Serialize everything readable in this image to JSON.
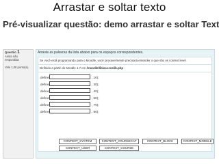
{
  "slide": {
    "title": "Arrastar e soltar texto"
  },
  "page": {
    "heading": "Pré-visualizar questão: demo arrastar e soltar Texto"
  },
  "info": {
    "question_label": "Questão",
    "question_number": "1",
    "status_line1": "Ainda não",
    "status_line2": "respondida",
    "score": "Vale 1,00 ponto(s)."
  },
  "question": {
    "prompt": "Arraste as palavras da lista abaixo para os espaços correspondentes.",
    "intro": "Se você está programando para o Moodle, você provavelmente precisará entender o que são os context level.",
    "defined_prefix": "Definido a partir do Moodle 1.7 em",
    "defined_file": "/moodle/lib/accesslib.php",
    "rows": [
      {
        "label": "define(",
        "value": ", 10);"
      },
      {
        "label": "define(",
        "value": ", 30);"
      },
      {
        "label": "define(",
        "value": ", 40);"
      },
      {
        "label": "define(",
        "value": ", 50);"
      },
      {
        "label": "define(",
        "value": ", 70);"
      },
      {
        "label": "define(",
        "value": ", 80);"
      }
    ],
    "choices": [
      "CONTEXT_SYSTEM",
      "CONTEXT_COURSECAT",
      "CONTEXT_BLOCK",
      "CONTEXT_MODULE",
      "CONTEXT_USER",
      "CONTEXT_COURSE"
    ]
  }
}
